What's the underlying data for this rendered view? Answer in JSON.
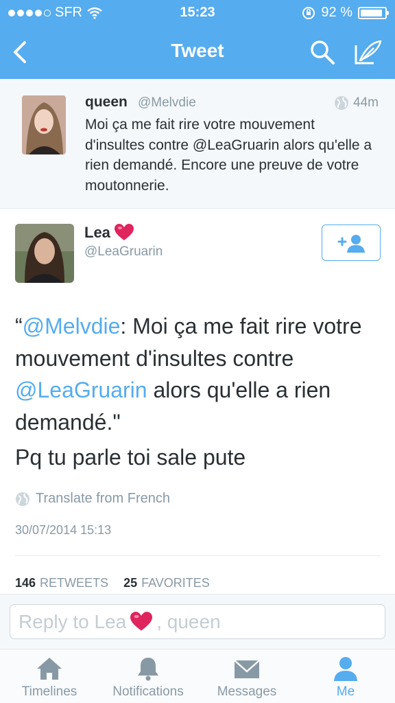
{
  "status_bar": {
    "carrier": "SFR",
    "time": "15:23",
    "battery": "92 %",
    "battery_level": 0.92
  },
  "nav": {
    "title": "Tweet",
    "icons": [
      "back-chevron-icon",
      "search-icon",
      "compose-icon"
    ]
  },
  "parent_tweet": {
    "name": "queen",
    "handle": "@Melvdie",
    "time": "44m",
    "text": "Moi ça me fait rire votre mouvement d'insultes contre @LeaGruarin alors qu'elle a rien demandé. Encore une preuve de votre moutonnerie."
  },
  "main_tweet": {
    "name": "Lea",
    "name_emoji": "❤️",
    "handle": "@LeaGruarin",
    "quote_open": "“",
    "mention1": "@Melvdie",
    "text_part1": ": Moi ça me fait rire votre mouvement d'insultes contre ",
    "mention2": "@LeaGruarin",
    "text_part2": " alors qu'elle a rien demandé.\"",
    "text2": "Pq tu parle toi sale pute",
    "translate": "Translate from French",
    "date": "30/07/2014 15:13",
    "retweets_count": "146",
    "retweets_label": "RETWEETS",
    "favorites_count": "25",
    "favorites_label": "FAVORITES"
  },
  "reply": {
    "prefix": "Reply to Lea",
    "emoji": "❤️",
    "suffix": ", queen"
  },
  "tabs": [
    {
      "label": "Timelines",
      "icon": "home-icon",
      "active": false
    },
    {
      "label": "Notifications",
      "icon": "bell-icon",
      "active": false
    },
    {
      "label": "Messages",
      "icon": "envelope-icon",
      "active": false
    },
    {
      "label": "Me",
      "icon": "person-icon",
      "active": true
    }
  ],
  "colors": {
    "brand": "#55acee",
    "muted": "#8899a6",
    "text": "#292f33",
    "heart": "#e0245e"
  }
}
